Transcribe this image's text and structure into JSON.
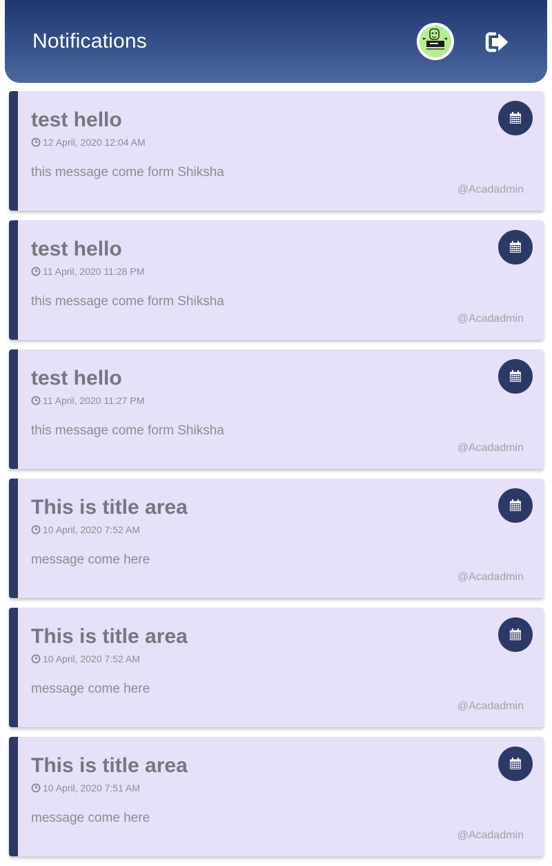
{
  "header": {
    "title": "Notifications",
    "avatar_icon": "user-avatar",
    "logout_icon": "logout-icon"
  },
  "colors": {
    "header_gradient_start": "#213672",
    "header_gradient_end": "#4d689f",
    "card_background": "#e6e0f8",
    "card_accent": "#2c3966",
    "title_text": "#73787e"
  },
  "notifications": [
    {
      "title": "test hello",
      "time": "12 April, 2020 12:04 AM",
      "message": "this message come form Shiksha",
      "author": "@Acadadmin"
    },
    {
      "title": "test hello",
      "time": "11 April, 2020 11:28 PM",
      "message": "this message come form Shiksha",
      "author": "@Acadadmin"
    },
    {
      "title": "test hello",
      "time": "11 April, 2020 11:27 PM",
      "message": "this message come form Shiksha",
      "author": "@Acadadmin"
    },
    {
      "title": "This is title area",
      "time": "10 April, 2020 7:52 AM",
      "message": "message come here",
      "author": "@Acadadmin"
    },
    {
      "title": "This is title area",
      "time": "10 April, 2020 7:52 AM",
      "message": "message come here",
      "author": "@Acadadmin"
    },
    {
      "title": "This is title area",
      "time": "10 April, 2020 7:51 AM",
      "message": "message come here",
      "author": "@Acadadmin"
    }
  ]
}
